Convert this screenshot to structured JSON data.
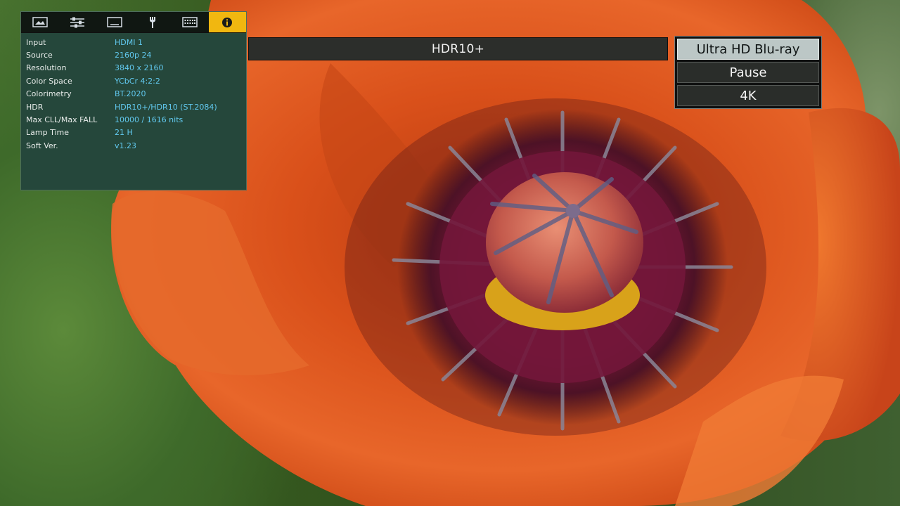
{
  "menu": {
    "tabs": [
      {
        "icon": "picture-icon"
      },
      {
        "icon": "sliders-icon"
      },
      {
        "icon": "screen-icon"
      },
      {
        "icon": "wrench-icon"
      },
      {
        "icon": "keyboard-icon"
      },
      {
        "icon": "info-icon",
        "active": true
      }
    ],
    "rows": [
      {
        "label": "Input",
        "value": "HDMI 1"
      },
      {
        "label": "Source",
        "value": "2160p 24"
      },
      {
        "label": "Resolution",
        "value": "3840 x 2160"
      },
      {
        "label": "Color Space",
        "value": "YCbCr 4:2:2"
      },
      {
        "label": "Colorimetry",
        "value": "BT.2020"
      },
      {
        "label": "HDR",
        "value": "HDR10+/HDR10 (ST.2084)"
      },
      {
        "label": "Max CLL/Max FALL",
        "value": "10000 / 1616 nits"
      },
      {
        "label": "Lamp Time",
        "value": "21 H"
      },
      {
        "label": "Soft Ver.",
        "value": "v1.23"
      }
    ],
    "colors": {
      "active_tab": "#f1b710",
      "label": "#e8ecea",
      "value": "#61c8ee",
      "panel": "#25473b"
    }
  },
  "hdr_bar": {
    "text": "HDR10+"
  },
  "status": {
    "items": [
      {
        "text": "Ultra HD Blu-ray",
        "highlight": true
      },
      {
        "text": "Pause"
      },
      {
        "text": "4K"
      }
    ]
  }
}
